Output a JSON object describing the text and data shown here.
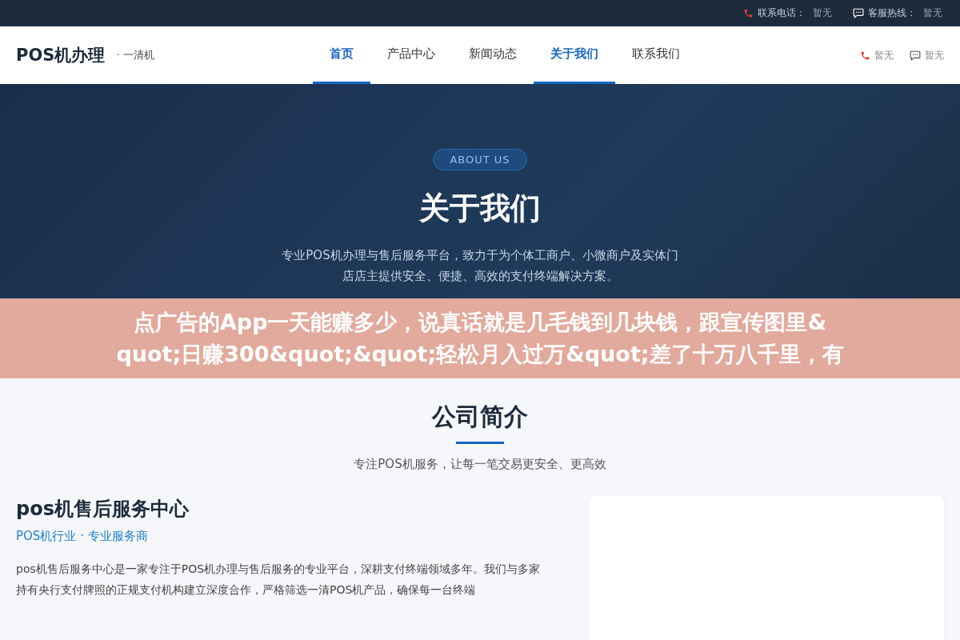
{
  "top_bar": {
    "items": [
      {
        "kind": "phone",
        "label": "联系电话：",
        "value": "暂无"
      },
      {
        "kind": "chat",
        "label": "客服热线：",
        "value": "暂无"
      }
    ]
  },
  "header": {
    "logo": "POS机办理",
    "tagline": "· 一清机",
    "nav": [
      {
        "label": "首页",
        "selected": true
      },
      {
        "label": "产品中心",
        "selected": false
      },
      {
        "label": "新闻动态",
        "selected": false
      },
      {
        "label": "关于我们",
        "selected": true
      },
      {
        "label": "联系我们",
        "selected": false
      }
    ],
    "contacts": [
      {
        "kind": "phone",
        "value": "暂无"
      },
      {
        "kind": "chat",
        "value": "暂无"
      }
    ]
  },
  "hero": {
    "badge": "ABOUT US",
    "title": "关于我们",
    "subtitle_lines": [
      "专业POS机办理与售后服务平台，致力于为个体工商户、小微商户及实体门",
      "店店主提供安全、便捷、高效的支付终端解决方案。"
    ]
  },
  "overlay_banner": {
    "lines": [
      "点广告的App一天能赚多少，说真话就是几毛钱到几块钱，跟宣传图里&",
      "quot;日赚300&quot;&quot;轻松月入过万&quot;差了十万八千里，有"
    ]
  },
  "intro": {
    "title": "公司简介",
    "subtitle": "专注POS机服务，让每一笔交易更安全、更高效"
  },
  "company": {
    "name": "pos机售后服务中心",
    "tagline": "POS机行业 · 专业服务商",
    "description": "pos机售后服务中心是一家专注于POS机办理与售后服务的专业平台，深耕支付终端领域多年。我们与多家持有央行支付牌照的正规支付机构建立深度合作，严格筛选一清POS机产品，确保每一台终端"
  }
}
